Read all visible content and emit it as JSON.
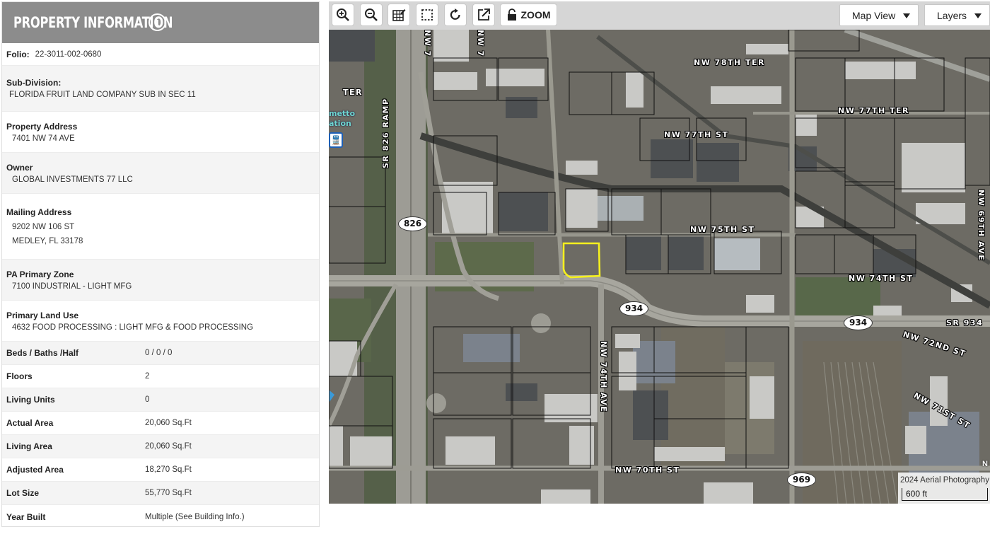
{
  "panel": {
    "title": "PROPERTY INFORMATION",
    "folio_label": "Folio:",
    "folio_value": "22-3011-002-0680",
    "subdivision_label": "Sub-Division:",
    "subdivision_value": "FLORIDA FRUIT LAND COMPANY SUB IN SEC 11",
    "address_label": "Property Address",
    "address_value": "7401 NW 74 AVE",
    "owner_label": "Owner",
    "owner_value": "GLOBAL INVESTMENTS 77 LLC",
    "mailing_label": "Mailing Address",
    "mailing_line1": "9202 NW 106 ST",
    "mailing_line2": "MEDLEY, FL 33178",
    "zone_label": "PA Primary Zone",
    "zone_value": "7100 INDUSTRIAL - LIGHT MFG",
    "landuse_label": "Primary Land Use",
    "landuse_value": "4632 FOOD PROCESSING : LIGHT MFG & FOOD PROCESSING",
    "details": [
      {
        "label": "Beds / Baths /Half",
        "value": "0 / 0 / 0"
      },
      {
        "label": "Floors",
        "value": "2"
      },
      {
        "label": "Living Units",
        "value": "0"
      },
      {
        "label": "Actual Area",
        "value": "20,060 Sq.Ft"
      },
      {
        "label": "Living Area",
        "value": "20,060 Sq.Ft"
      },
      {
        "label": "Adjusted Area",
        "value": "18,270 Sq.Ft"
      },
      {
        "label": "Lot Size",
        "value": "55,770 Sq.Ft"
      },
      {
        "label": "Year Built",
        "value": "Multiple (See Building Info.)"
      }
    ]
  },
  "toolbar": {
    "zoom_label": "ZOOM",
    "map_view_label": "Map View",
    "layers_label": "Layers",
    "icons": [
      "zoom-in-icon",
      "zoom-out-icon",
      "edit-map-icon",
      "select-box-icon",
      "refresh-icon",
      "external-link-icon",
      "lock-icon"
    ]
  },
  "map": {
    "streets": {
      "nw78": "NW 78TH TER",
      "nw77ter": "NW 77TH TER",
      "nw77st": "NW 77TH ST",
      "nw75": "NW 75TH ST",
      "nw74": "NW 74TH ST",
      "sr934": "SR 934",
      "nw72": "NW 72ND ST",
      "nw71": "NW 71ST ST",
      "nw70": "NW 70TH ST",
      "nw74ave": "NW 74TH AVE",
      "nw69ave": "NW 69TH AVE",
      "sr826": "SR 826 RAMP",
      "ter_left": "TER",
      "nw7a": "NW 7",
      "nw7b": "NW 7"
    },
    "shields": {
      "s826": "826",
      "s934a": "934",
      "s934b": "934",
      "s969": "969"
    },
    "station_line1": "metto",
    "station_line2": "ation",
    "transit_glyph": "🚆",
    "scale_caption": "2024 Aerial Photography",
    "scale_label": "600 ft",
    "north_label": "N",
    "highlight_color": "#f5f01e",
    "parcel_line_color": "#111111"
  }
}
